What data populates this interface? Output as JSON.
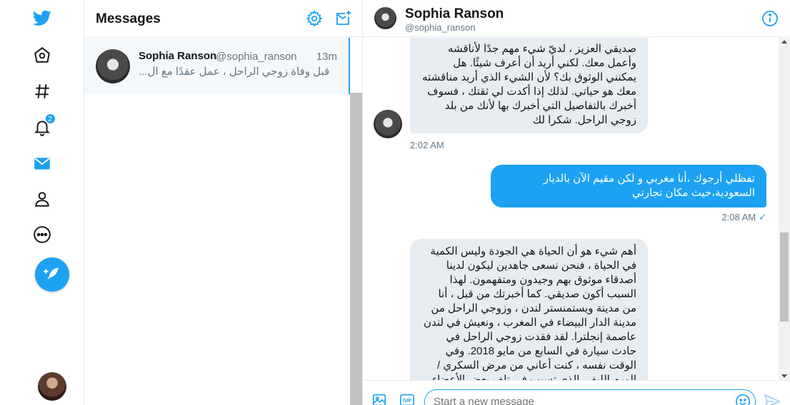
{
  "nav": {
    "items": [
      {
        "name": "twitter-logo-icon"
      },
      {
        "name": "home-icon"
      },
      {
        "name": "explore-hashtag-icon"
      },
      {
        "name": "notifications-bell-icon",
        "badge": "2"
      },
      {
        "name": "messages-mail-icon"
      },
      {
        "name": "profile-person-icon"
      },
      {
        "name": "more-ellipsis-icon"
      }
    ],
    "compose_icon": "feather-plus-icon"
  },
  "colors": {
    "accent": "#1da1f2",
    "text": "#14171a",
    "muted": "#657786",
    "bubble_in": "#e6ecf0",
    "border": "#e6ecf0"
  },
  "list": {
    "title": "Messages",
    "settings_icon": "gear-icon",
    "new_message_icon": "new-message-icon",
    "conversations": [
      {
        "name": "Sophia Ranson",
        "handle": "@sophia_ranson",
        "time": "13m",
        "snippet": "قبل وفاة زوجي الراحل ، عمل عقدًا مع ال..."
      }
    ]
  },
  "chat": {
    "name": "Sophia Ranson",
    "handle": "@sophia_ranson",
    "info_icon": "info-icon",
    "messages": [
      {
        "direction": "in",
        "text": "صديقي العزيز ، لديّ شيء مهم جدًا لأناقشه وأعمل معك. لكني أريد أن أعرف شيئًا. هل يمكنني الوثوق بك؟ لأن الشيء الذي أريد مناقشته معك هو حياتي. لذلك إذا أكدت لي ثقتك ، فسوف أخبرك بالتفاصيل التي أخبرك بها لأنك من بلد زوجي الراحل. شكرا لك",
        "time": "2:02 AM"
      },
      {
        "direction": "out",
        "text": "تفظلي أرجوك ،أنا مغربي و لكن مقيم الآن بالديار السعودية،حيث مكان تجارتي",
        "time": "2:08 AM",
        "status": "✓"
      },
      {
        "direction": "in",
        "text": "أهم شيء هو أن الحياة هي الجودة وليس الكمية في الحياة ، فنحن نسعى جاهدين ليكون لدينا أصدقاء موثوق بهم وجيدون ومتفهمون. لهذا السبب أكون صديقي. كما أخبرتك من قبل ، أنا من مدينة ويستمنستر لندن ، وزوجي الراحل من مدينة الدار البيضاء في المغرب ، ونعيش في لندن عاصمة إنجلترا. لقد فقدت زوجي الراحل في حادث سيارة في السابع من مايو 2018. وفي الوقت نفسه ، كنت أعاني من مرض السكري / الورم الليفي الذي تسبب في تلف بعض الأعضاء الحيوية"
      }
    ]
  },
  "composer": {
    "placeholder": "Start a new message",
    "media_icon": "image-icon",
    "gif_icon": "gif-icon",
    "emoji_icon": "emoji-icon",
    "send_icon": "send-icon"
  }
}
